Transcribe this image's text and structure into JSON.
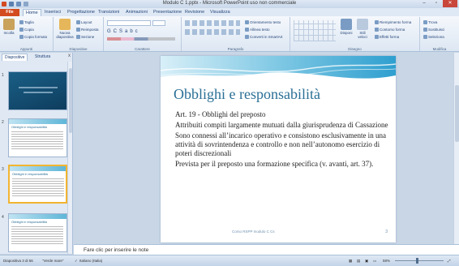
{
  "window": {
    "title": "Modulo C 1.pptx - Microsoft PowerPoint uso non commerciale"
  },
  "tabs": [
    "File",
    "Home",
    "Inserisci",
    "Progettazione",
    "Transizioni",
    "Animazioni",
    "Presentazione",
    "Revisione",
    "Visualizza"
  ],
  "ribbon": {
    "groups": [
      "Appunti",
      "Diapositive",
      "Carattere",
      "Paragrafo",
      "Disegno",
      "Modifica"
    ],
    "paste": "Incolla",
    "cut": "Taglia",
    "copy": "Copia",
    "format_painter": "Copia formato",
    "new_slide": "Nuova diapositiva",
    "layout": "Layout",
    "reset": "Reimposta",
    "section": "Sezione",
    "text_direction": "Orientamento testo",
    "align_text": "Allinea testo",
    "smartart": "Converti in SmartArt",
    "arrange": "Disponi",
    "quick_styles": "Stili veloci",
    "shape_fill": "Riempimento forma",
    "shape_outline": "Contorno forma",
    "shape_effects": "Effetti forma",
    "find": "Trova",
    "replace": "Sostituisci",
    "select": "Seleziona"
  },
  "pane": {
    "tabs": [
      "Diapositive",
      "Struttura"
    ],
    "close": "x"
  },
  "thumbnails": [
    {
      "num": "1",
      "title": ""
    },
    {
      "num": "2",
      "title": "Obblighi e responsabilità"
    },
    {
      "num": "3",
      "title": "Obblighi e responsabilità"
    },
    {
      "num": "4",
      "title": "Obblighi e responsabilità"
    }
  ],
  "slide": {
    "title": "Obblighi e responsabilità",
    "lines": [
      "Art. 19 - Obblighi del preposto",
      "Attribuiti compiti largamente mutuati dalla giurisprudenza di Cassazione",
      "Sono connessi all’incarico operativo e consistono esclusivamente in una attività di sovrintendenza e controllo e non nell’autonomo esercizio di poteri discrezionali",
      "Prevista per il preposto una formazione specifica (v. avanti, art. 37)."
    ],
    "footer": "Corso RSPP modulo C   Cs",
    "number": "3"
  },
  "notes_placeholder": "Fare clic per inserire le note",
  "status": {
    "slide_info": "Diapositiva 3 di 56",
    "theme": "\"Verde mare\"",
    "language": "Italiano (Italia)",
    "zoom": "58%"
  }
}
